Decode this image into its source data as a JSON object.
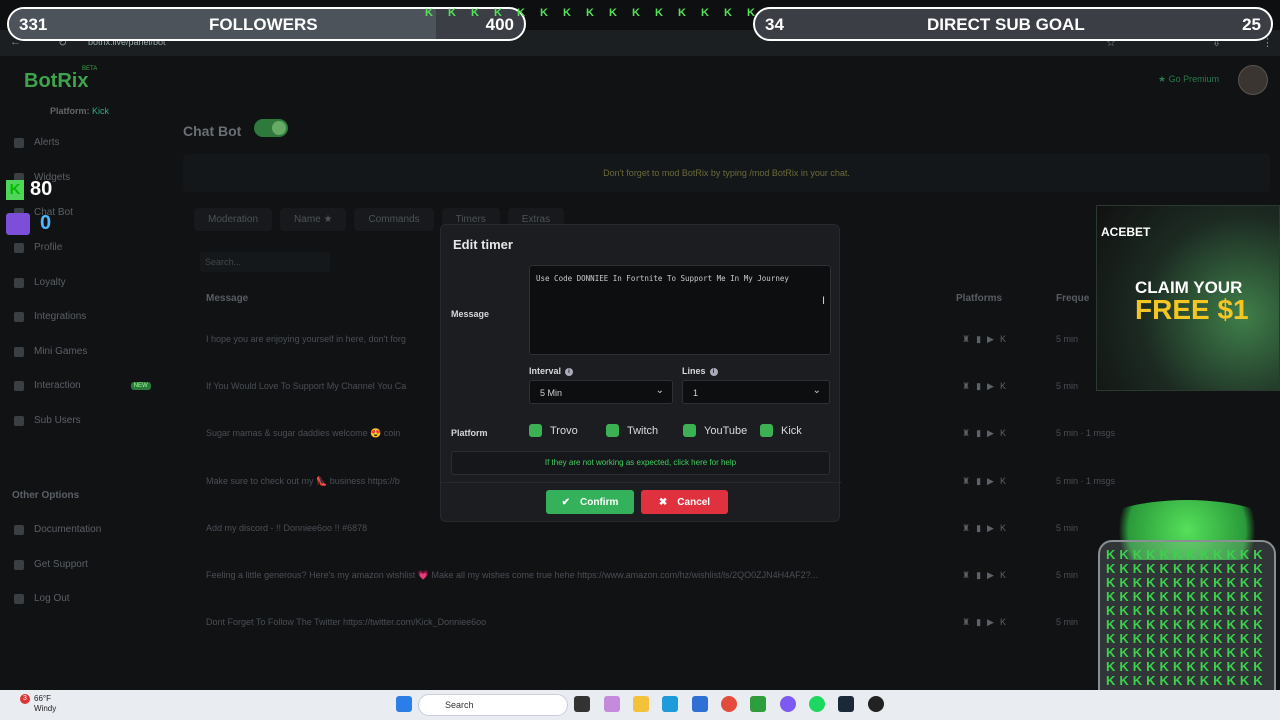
{
  "browser": {
    "url": "botrix.live/panel/bot"
  },
  "overlay": {
    "followers": {
      "current": "331",
      "label": "FOLLOWERS",
      "goal": "400",
      "progress": 0.83
    },
    "subs": {
      "current": "34",
      "label": "DIRECT SUB GOAL",
      "goal": "25"
    },
    "k_strip": "K K K K K K K K K K K K K K K K K K",
    "kick_count": "80",
    "twitch_count": "0"
  },
  "app": {
    "logo": "BotRix",
    "beta": "BETA",
    "platform_label": "Platform:",
    "platform_value": "Kick",
    "premium": "★ Go Premium",
    "sidebar": [
      {
        "label": "Alerts"
      },
      {
        "label": "Widgets"
      },
      {
        "label": "Chat Bot"
      },
      {
        "label": "Profile"
      },
      {
        "label": "Loyalty"
      },
      {
        "label": "Integrations"
      },
      {
        "label": "Mini Games"
      },
      {
        "label": "Interaction",
        "badge": "NEW"
      },
      {
        "label": "Sub Users"
      }
    ],
    "sidebar_other_head": "Other Options",
    "sidebar_other": [
      {
        "label": "Documentation"
      },
      {
        "label": "Get Support"
      },
      {
        "label": "Log Out"
      }
    ],
    "page_title": "Chat Bot",
    "notice": "Don't forget to mod BotRix by typing /mod BotRix in your chat.",
    "tabs": [
      "Moderation",
      "Name ★",
      "Commands",
      "Timers",
      "Extras"
    ],
    "search_placeholder": "Search...",
    "table": {
      "col_message": "Message",
      "col_platforms": "Platforms",
      "col_frequency": "Freque",
      "rows": [
        {
          "message": "I hope you are enjoying yourself in here, don't forg",
          "freq": "5 min"
        },
        {
          "message": "If You Would Love To Support My Channel You Ca",
          "freq": "5 min"
        },
        {
          "message": "Sugar mamas & sugar daddies welcome 😍 coin",
          "freq": "5 min · 1 msgs"
        },
        {
          "message": "Make sure to check out my 👠 business https://b",
          "freq": "5 min · 1 msgs"
        },
        {
          "message": "Add my discord - !! Donniee6oo !! #6878",
          "freq": "5 min"
        },
        {
          "message": "Feeling a little generous? Here's my amazon wishlist 💗 Make all my wishes come true hehe https://www.amazon.com/hz/wishlist/ls/2QO0ZJN4H4AF2?...",
          "freq": "5 min"
        },
        {
          "message": "Dont Forget To Follow The Twitter https://twitter.com/Kick_Donniee6oo",
          "freq": "5 min"
        }
      ]
    }
  },
  "dialog": {
    "title": "Edit timer",
    "message_label": "Message",
    "message_value": "Use Code DONNIEE In Fortnite To Support Me In My Journey",
    "interval_label": "Interval",
    "interval_value": "5 Min",
    "lines_label": "Lines",
    "lines_value": "1",
    "platform_label": "Platform",
    "platforms": [
      "Trovo",
      "Twitch",
      "YouTube",
      "Kick"
    ],
    "help": "If they are not working as expected, click here for help",
    "confirm": "Confirm",
    "cancel": "Cancel"
  },
  "promo": {
    "brand": "ACEBET",
    "line1": "CLAIM YOUR",
    "line2": "FREE $1"
  },
  "taskbar": {
    "temp": "66°F",
    "condition": "Windy",
    "badge": "3",
    "search": "Search"
  }
}
